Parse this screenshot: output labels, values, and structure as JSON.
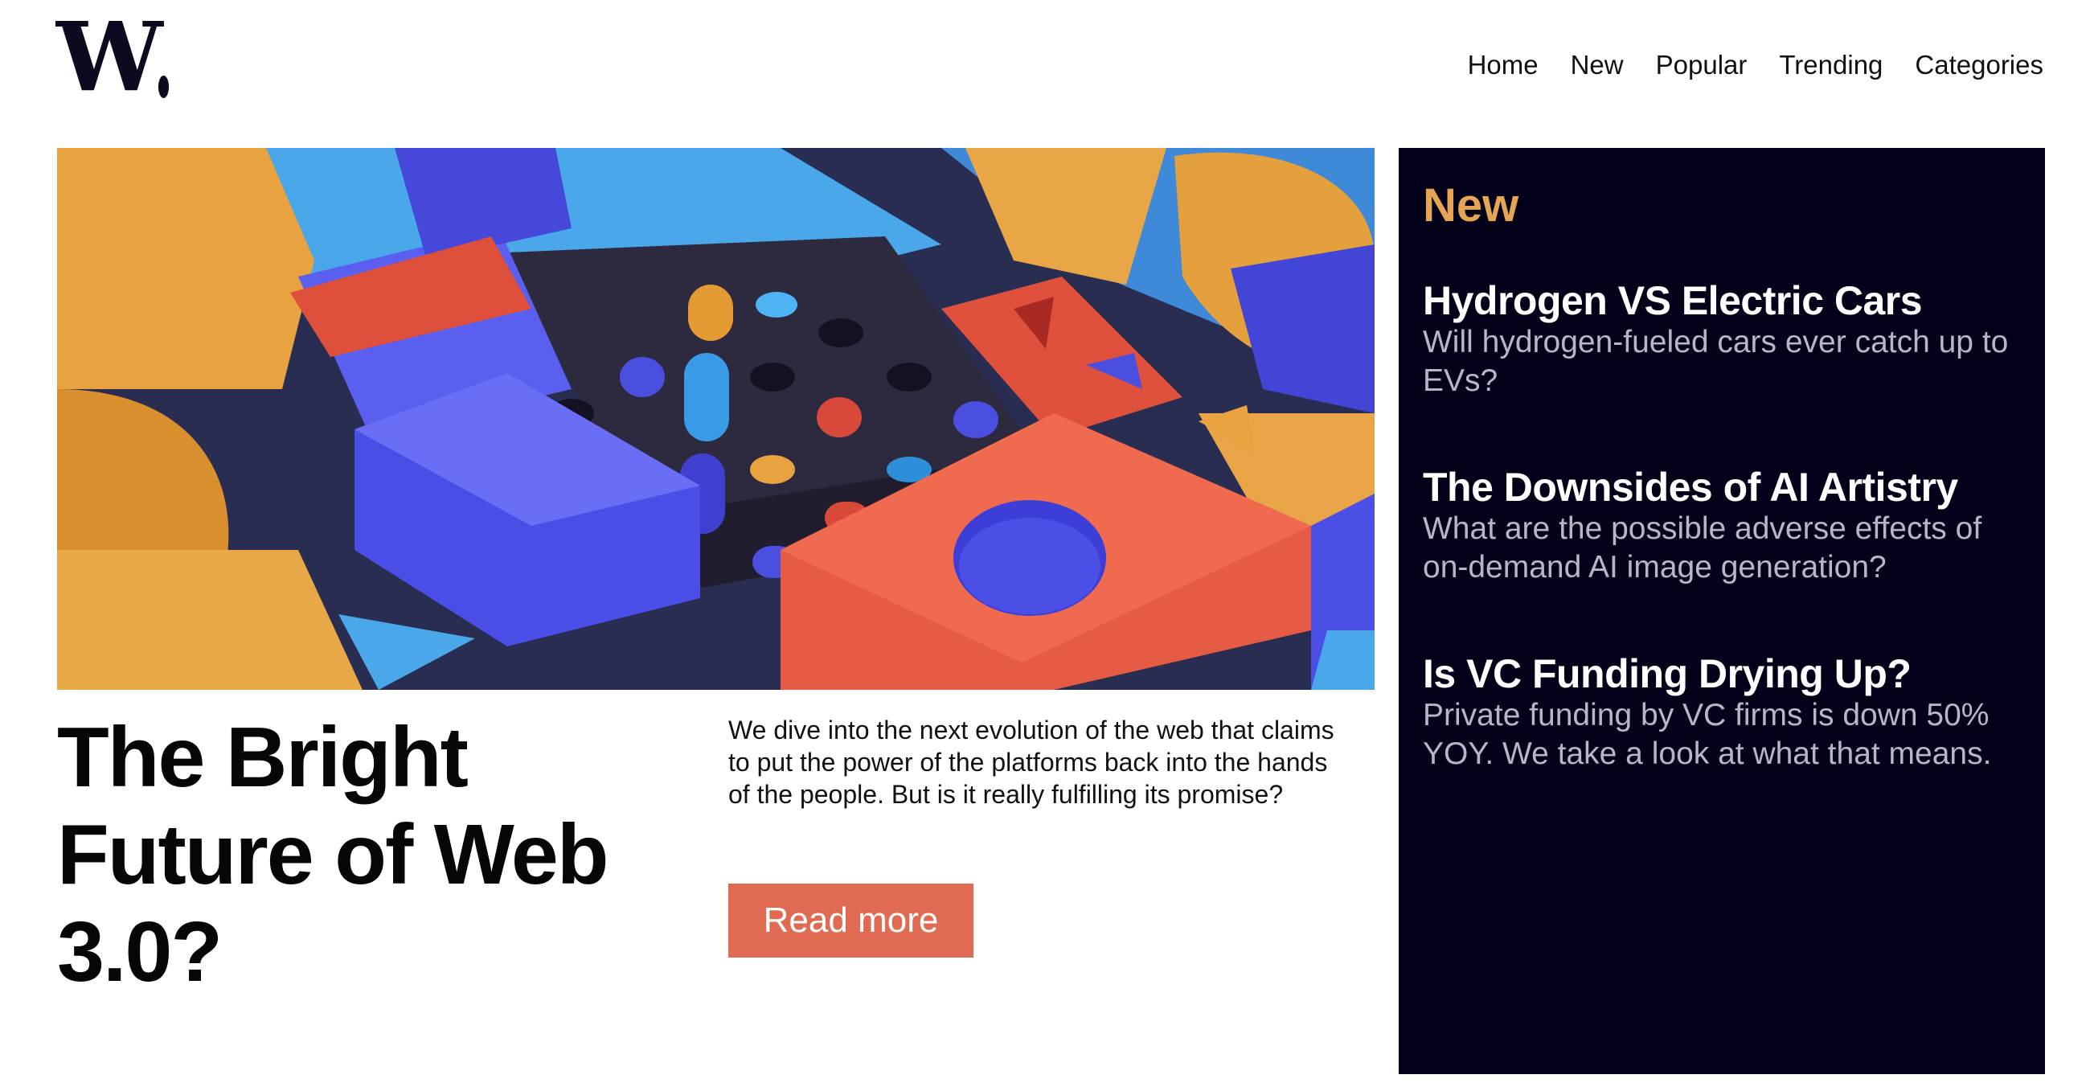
{
  "brand": {
    "logo_letter": "W",
    "logo_alt": "W."
  },
  "nav": {
    "items": [
      {
        "label": "Home"
      },
      {
        "label": "New"
      },
      {
        "label": "Popular"
      },
      {
        "label": "Trending"
      },
      {
        "label": "Categories"
      }
    ]
  },
  "hero": {
    "image_alt": "3D colorful abstract blocks illustration",
    "headline": "The Bright Future of Web 3.0?",
    "summary": "We dive into the next evolution of the web that claims to put the power of the platforms back into the hands of the people. But is it really fulfilling its promise?",
    "cta_label": "Read more"
  },
  "sidebar": {
    "title": "New",
    "articles": [
      {
        "title": "Hydrogen VS Electric Cars",
        "description": "Will hydrogen-fueled cars ever catch up to EVs?"
      },
      {
        "title": "The Downsides of AI Artistry",
        "description": "What are the possible adverse effects of on-demand AI image generation?"
      },
      {
        "title": "Is VC Funding Drying Up?",
        "description": "Private funding by VC firms is down 50% YOY. We take a look at what that means."
      }
    ]
  },
  "colors": {
    "accent": "#e06b52",
    "sidebar_bg": "#03001a",
    "sidebar_title": "#e6a554",
    "sidebar_desc": "#b9b5c4"
  }
}
